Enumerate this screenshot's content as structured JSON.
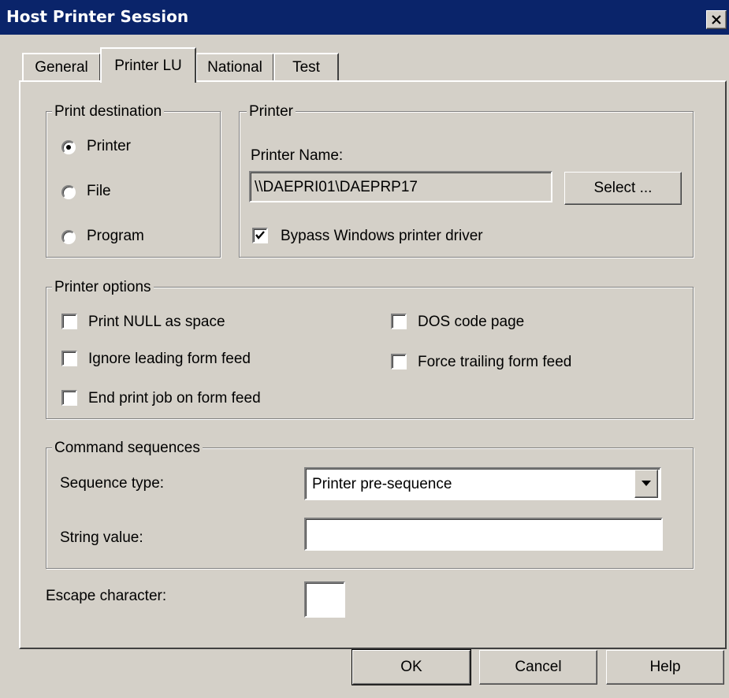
{
  "window": {
    "title": "Host Printer Session"
  },
  "tabs": [
    {
      "label": "General"
    },
    {
      "label": "Printer LU"
    },
    {
      "label": "National"
    },
    {
      "label": "Test"
    }
  ],
  "print_destination": {
    "label": "Print destination",
    "options": [
      "Printer",
      "File",
      "Program"
    ],
    "selected": "Printer"
  },
  "printer": {
    "label": "Printer",
    "name_label": "Printer Name:",
    "name_value": "\\\\DAEPRI01\\DAEPRP17",
    "select_button": "Select ...",
    "bypass_label": "Bypass Windows printer driver",
    "bypass_checked": true
  },
  "printer_options": {
    "label": "Printer options",
    "print_null": "Print NULL as space",
    "ignore_ff": "Ignore leading form feed",
    "end_job": "End print job on form feed",
    "dos_cp": "DOS code page",
    "force_ff": "Force trailing form feed"
  },
  "command_sequences": {
    "label": "Command sequences",
    "seq_type_label": "Sequence type:",
    "seq_type_value": "Printer pre-sequence",
    "string_label": "String value:",
    "string_value": ""
  },
  "escape": {
    "label": "Escape character:",
    "value": ""
  },
  "buttons": {
    "ok": "OK",
    "cancel": "Cancel",
    "help": "Help"
  }
}
